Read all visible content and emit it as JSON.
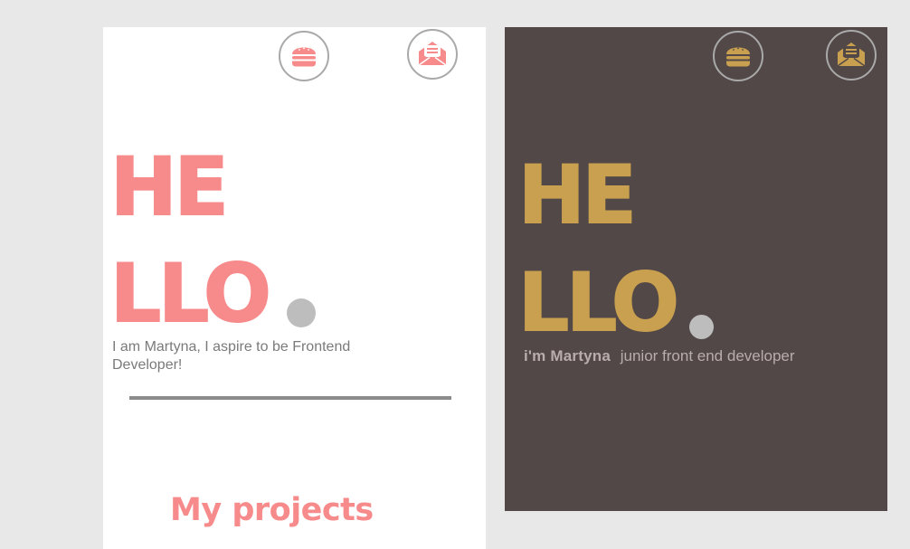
{
  "light": {
    "menu_icon": "burger-icon",
    "mail_icon": "open-envelope-icon",
    "hello_line1": "HE",
    "hello_line2": "LLO",
    "intro": "I  am Martyna, I aspire to be Frontend Developer!",
    "projects_heading": "My projects",
    "colors": {
      "background": "#ffffff",
      "accent": "#f78a8a",
      "dot": "#bdbdbd",
      "text": "#7a7a7a",
      "divider": "#8c8c8c"
    }
  },
  "dark": {
    "menu_icon": "burger-icon",
    "mail_icon": "open-envelope-icon",
    "hello_line1": "HE",
    "hello_line2": "LLO",
    "intro_name": "i'm Martyna",
    "intro_role": "junior front end developer",
    "colors": {
      "background": "#524847",
      "accent": "#c8a04f",
      "dot": "#bdbdbd",
      "text": "#b9adac"
    }
  }
}
